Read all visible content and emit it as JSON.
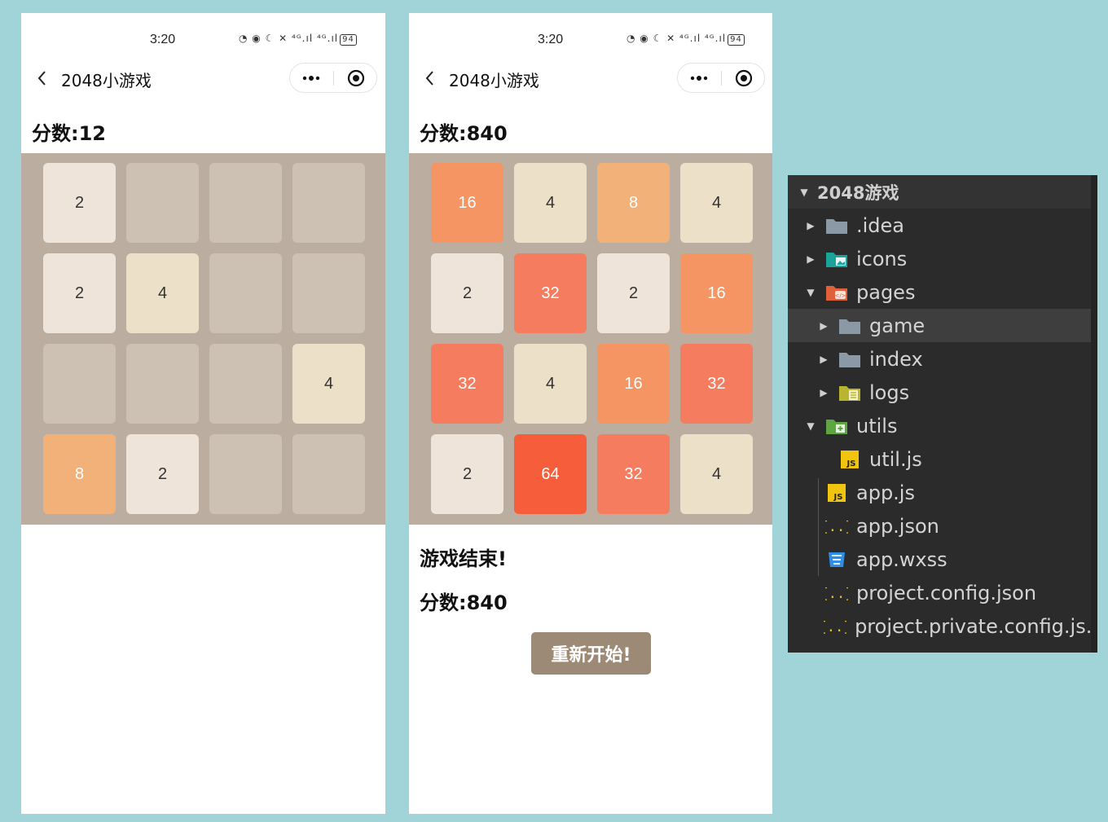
{
  "phones": [
    {
      "status_time": "3:20",
      "status_indicators": "◔ ◉ ☾ ✕ ⁴ᴳ.ıl ⁴ᴳ.ıl",
      "battery": "94",
      "title": "2048小游戏",
      "score_text": "分数:12",
      "board": [
        [
          2,
          0,
          0,
          0
        ],
        [
          2,
          4,
          0,
          0
        ],
        [
          0,
          0,
          0,
          4
        ],
        [
          8,
          2,
          0,
          0
        ]
      ]
    },
    {
      "status_time": "3:20",
      "status_indicators": "◔ ◉ ☾ ✕ ⁴ᴳ.ıl ⁴ᴳ.ıl",
      "battery": "94",
      "title": "2048小游戏",
      "score_text": "分数:840",
      "board": [
        [
          16,
          4,
          8,
          4
        ],
        [
          2,
          32,
          2,
          16
        ],
        [
          32,
          4,
          16,
          32
        ],
        [
          2,
          64,
          32,
          4
        ]
      ],
      "game_over_text": "游戏结束!",
      "final_score_text": "分数:840",
      "restart_label": "重新开始!"
    }
  ],
  "tile_colors": {
    "empty": "#cdc1b4",
    "2": "#eee4da",
    "4": "#ede0c8",
    "8": "#f2b179",
    "16": "#f59563",
    "32": "#f67c5f",
    "64": "#f65e3b"
  },
  "explorer": {
    "root": "2048游戏",
    "items": [
      {
        "label": ".idea",
        "icon": "folder-icon",
        "expanded": false
      },
      {
        "label": "icons",
        "icon": "images-folder-icon",
        "expanded": false
      },
      {
        "label": "pages",
        "icon": "pages-folder-icon",
        "expanded": true
      },
      {
        "label": "game",
        "icon": "folder-icon",
        "expanded": false,
        "selected": true
      },
      {
        "label": "index",
        "icon": "folder-icon",
        "expanded": false
      },
      {
        "label": "logs",
        "icon": "logs-folder-icon",
        "expanded": false
      },
      {
        "label": "utils",
        "icon": "utils-folder-icon",
        "expanded": true
      },
      {
        "label": "util.js",
        "icon": "js-file-icon"
      },
      {
        "label": "app.js",
        "icon": "js-file-icon"
      },
      {
        "label": "app.json",
        "icon": "json-file-icon"
      },
      {
        "label": "app.wxss",
        "icon": "css-file-icon"
      },
      {
        "label": "project.config.json",
        "icon": "json-file-icon"
      },
      {
        "label": "project.private.config.js...",
        "icon": "json-file-icon"
      }
    ]
  }
}
